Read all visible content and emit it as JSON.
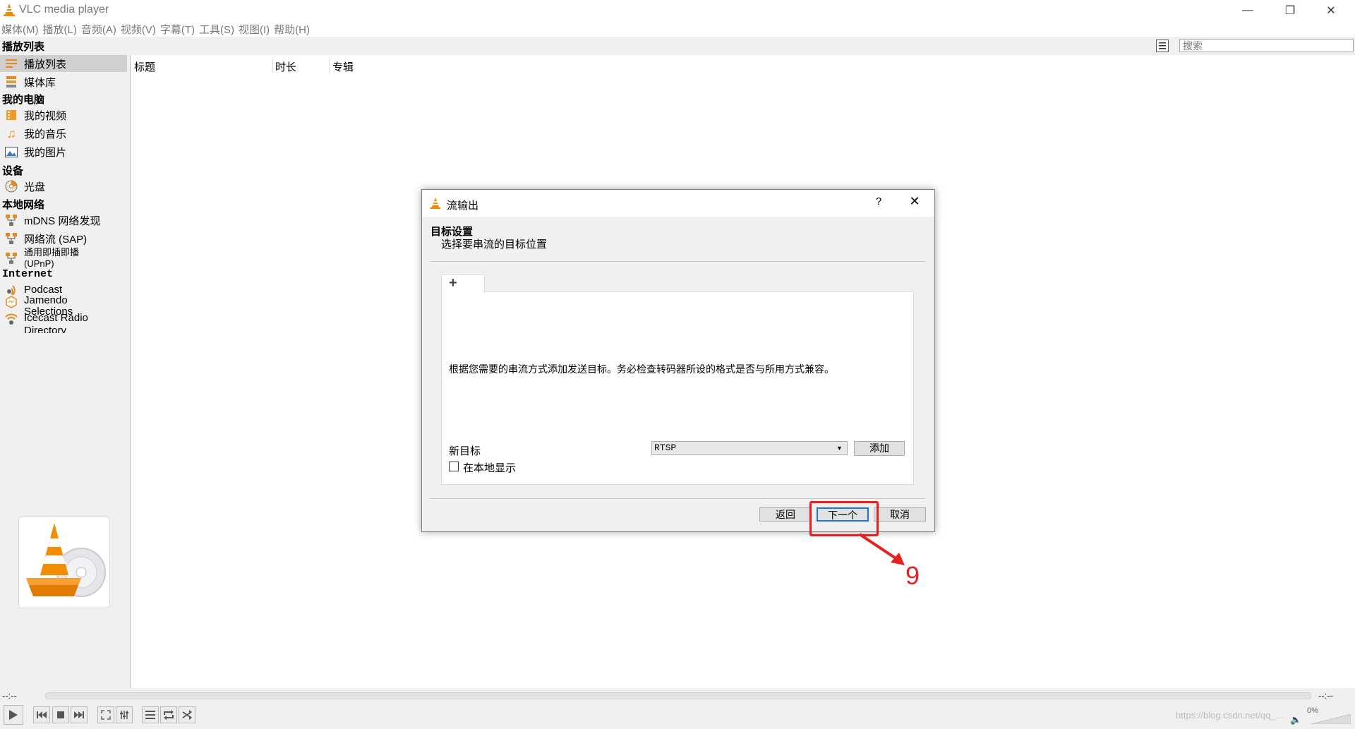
{
  "window": {
    "title": "VLC media player",
    "controls": {
      "minimize": "—",
      "restore": "❐",
      "close": "✕"
    }
  },
  "menu": [
    "媒体(M)",
    "播放(L)",
    "音频(A)",
    "视频(V)",
    "字幕(T)",
    "工具(S)",
    "视图(I)",
    "帮助(H)"
  ],
  "playlist_header": "播放列表",
  "search": {
    "placeholder": "搜索",
    "value": ""
  },
  "sidebar": {
    "top_items": [
      {
        "label": "播放列表",
        "icon": "playlist-icon",
        "selected": true
      },
      {
        "label": "媒体库",
        "icon": "media-library-icon"
      }
    ],
    "my_computer": {
      "title": "我的电脑",
      "items": [
        {
          "label": "我的视频",
          "icon": "video-folder-icon"
        },
        {
          "label": "我的音乐",
          "icon": "music-note-icon"
        },
        {
          "label": "我的图片",
          "icon": "picture-icon"
        }
      ]
    },
    "devices": {
      "title": "设备",
      "items": [
        {
          "label": "光盘",
          "icon": "disc-icon"
        }
      ]
    },
    "local_network": {
      "title": "本地网络",
      "items": [
        {
          "label": "mDNS 网络发现",
          "icon": "network-icon"
        },
        {
          "label": "网络流 (SAP)",
          "icon": "network-icon"
        },
        {
          "label": "通用即插即播 (UPnP)",
          "icon": "network-icon"
        }
      ]
    },
    "internet": {
      "title": "Internet",
      "items": [
        {
          "label": "Podcast",
          "icon": "podcast-icon"
        },
        {
          "label": "Jamendo Selections",
          "icon": "jamendo-icon"
        },
        {
          "label": "Icecast Radio Directory",
          "icon": "radio-icon"
        }
      ]
    }
  },
  "playlist": {
    "columns": [
      "标题",
      "时长",
      "专辑"
    ]
  },
  "player": {
    "elapsed": "--:--",
    "remaining": "--:--",
    "volume": "0%",
    "watermark": "https://blog.csdn.net/qq_..."
  },
  "dialog": {
    "title": "流输出",
    "help": "?",
    "close": "✕",
    "heading": "目标设置",
    "subheading": "选择要串流的目标位置",
    "tab_label": "+",
    "info": "根据您需要的串流方式添加发送目标。务必检查转码器所设的格式是否与所用方式兼容。",
    "new_target_label": "新目标",
    "target_value": "RTSP",
    "add_button": "添加",
    "local_display_label": "在本地显示",
    "local_display_checked": false,
    "buttons": {
      "back": "返回",
      "next": "下一个",
      "cancel": "取消"
    }
  },
  "annotation": {
    "number": "9",
    "color": "#e52222"
  }
}
